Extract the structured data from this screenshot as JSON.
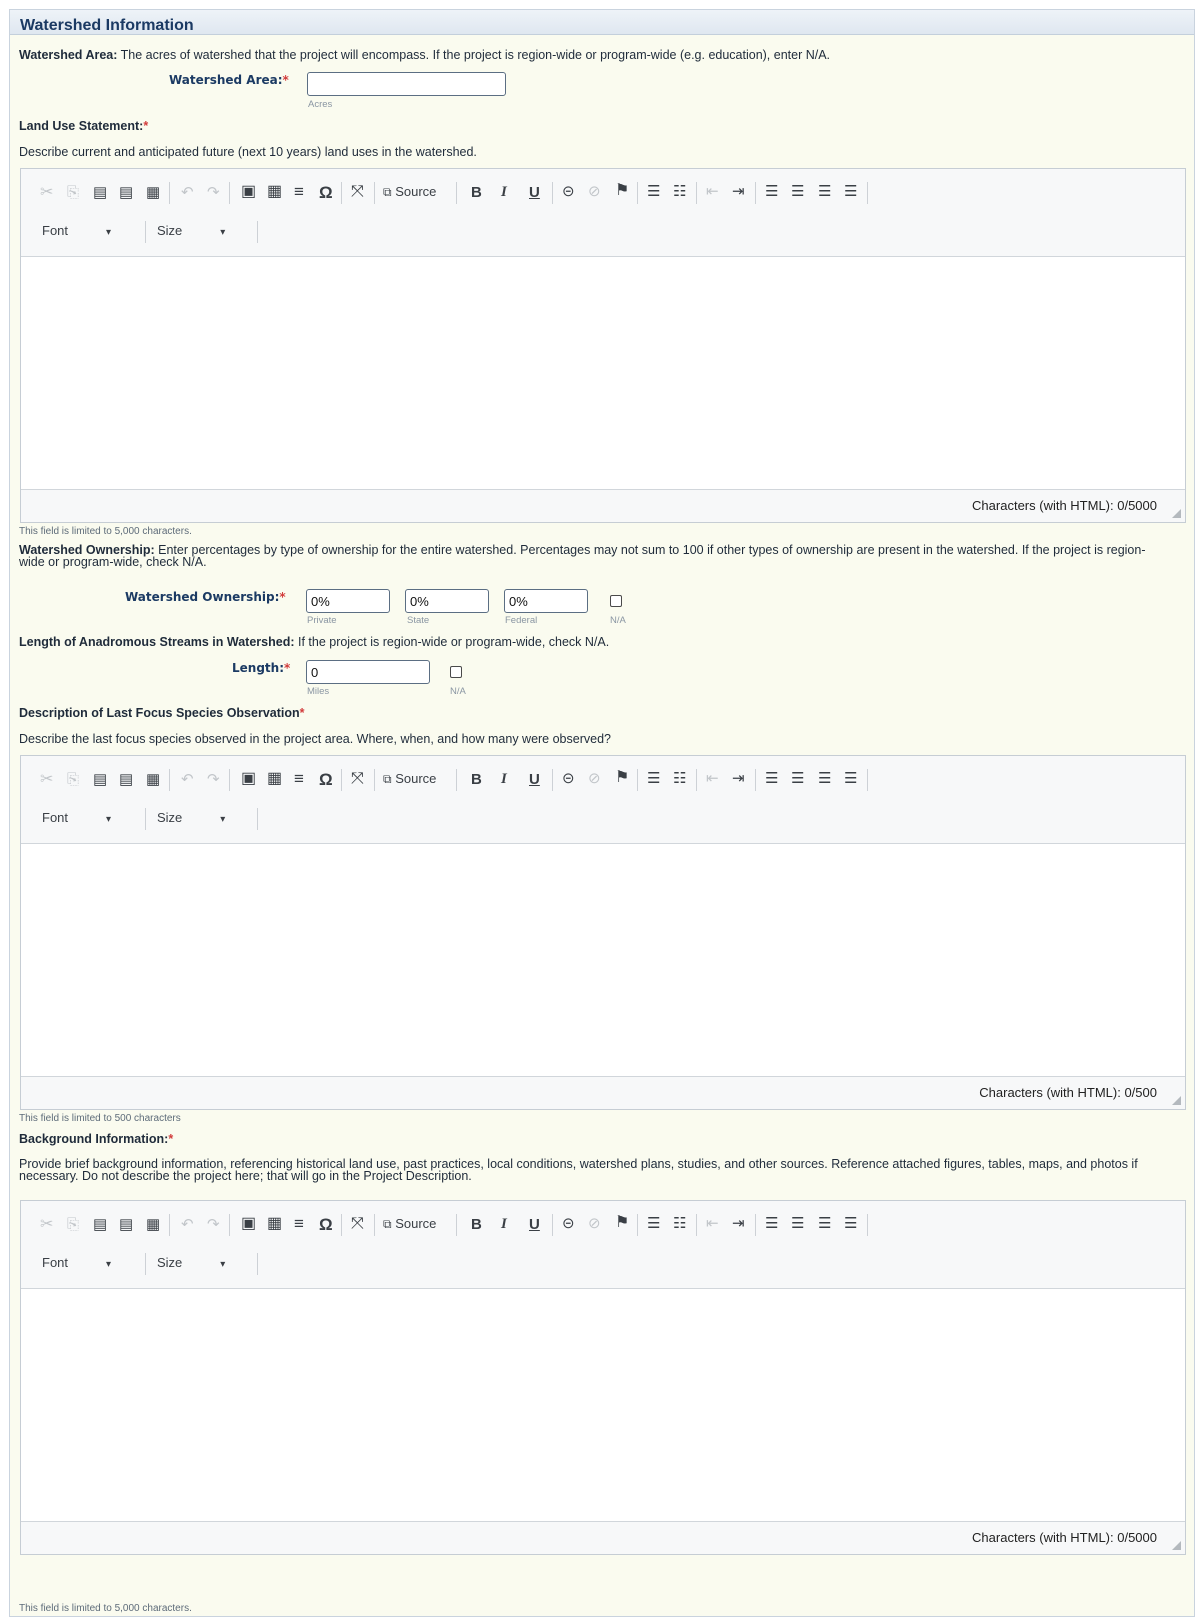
{
  "section": {
    "title": "Watershed Information"
  },
  "watershed_area": {
    "intro_bold": "Watershed Area:",
    "intro_text": " The acres of watershed that the project will encompass. If the project is region-wide or program-wide (e.g. education), enter N/A.",
    "label": "Watershed Area:",
    "required": "*",
    "value": "",
    "unit": "Acres"
  },
  "land_use": {
    "title": "Land Use Statement:",
    "required": "*",
    "description": "Describe current and anticipated future (next 10 years) land uses in the watershed.",
    "char_count": "Characters (with HTML): 0/5000",
    "limit_note": "This field is limited to 5,000 characters."
  },
  "ownership": {
    "intro_bold": "Watershed Ownership:",
    "intro_text": " Enter percentages by type of ownership for the entire watershed. Percentages may not sum to 100 if other types of ownership are present in the watershed. If the project is region-wide or program-wide, check N/A.",
    "label": "Watershed Ownership:",
    "required": "*",
    "private_value": "0%",
    "private_label": "Private",
    "state_value": "0%",
    "state_label": "State",
    "federal_value": "0%",
    "federal_label": "Federal",
    "na_label": "N/A"
  },
  "streams": {
    "intro_bold": "Length of Anadromous Streams in Watershed:",
    "intro_text": " If the project is region-wide or program-wide, check N/A.",
    "label": "Length:",
    "required": "*",
    "value": "0",
    "unit": "Miles",
    "na_label": "N/A"
  },
  "focus_species": {
    "title": "Description of Last Focus Species Observation",
    "required": "*",
    "description": "Describe the last focus species observed in the project area. Where, when, and how many were observed?",
    "char_count": "Characters (with HTML): 0/500",
    "limit_note": "This field is limited to 500 characters"
  },
  "background": {
    "title": "Background Information:",
    "required": "*",
    "description": "Provide brief background information, referencing historical land use, past practices, local conditions, watershed plans, studies, and other sources. Reference attached figures, tables, maps, and photos if necessary. Do not describe the project here; that will go in the Project Description.",
    "char_count": "Characters (with HTML): 0/5000",
    "limit_note": "This field is limited to 5,000 characters."
  },
  "toolbar": {
    "source_label": "Source",
    "bold_label": "B",
    "italic_label": "I",
    "underline_label": "U",
    "font_label": "Font",
    "size_label": "Size",
    "icons": [
      "cut-icon",
      "copy-icon",
      "paste-icon",
      "paste-text-icon",
      "paste-word-icon",
      "undo-icon",
      "redo-icon",
      "image-icon",
      "table-icon",
      "horizontal-rule-icon",
      "special-char-icon",
      "maximize-icon",
      "source-icon",
      "bold-icon",
      "italic-icon",
      "underline-icon",
      "link-icon",
      "unlink-icon",
      "anchor-icon",
      "numbered-list-icon",
      "bulleted-list-icon",
      "outdent-icon",
      "indent-icon",
      "align-left-icon",
      "align-center-icon",
      "align-right-icon",
      "justify-icon"
    ]
  },
  "colors": {
    "heading": "#1b3a63",
    "panel_bg": "#fafbef",
    "required": "#d23b3b"
  }
}
